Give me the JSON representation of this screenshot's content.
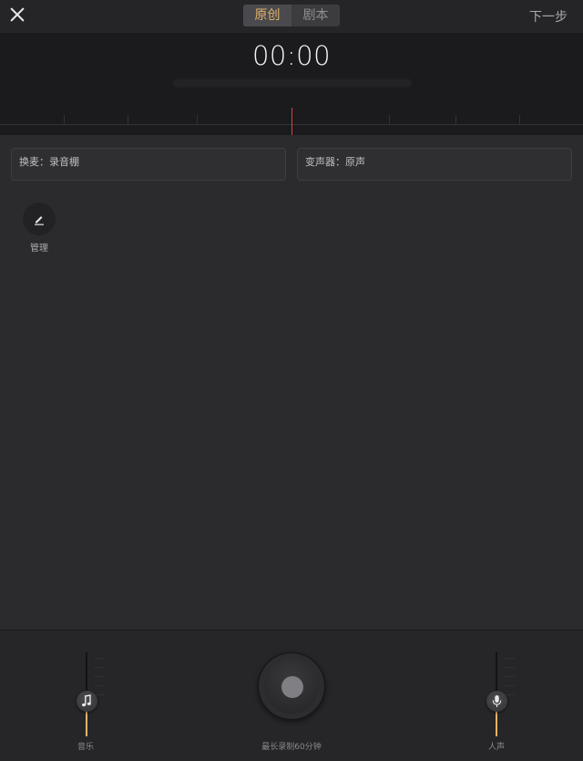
{
  "topbar": {
    "close_icon": "close-icon",
    "tabs": [
      {
        "label": "原创",
        "active": true
      },
      {
        "label": "剧本",
        "active": false
      }
    ],
    "next_label": "下一步"
  },
  "recorder": {
    "timer": "00:00"
  },
  "options": {
    "mic_label": "换麦：录音棚",
    "voice_changer_label": "变声器：原声"
  },
  "manage": {
    "icon": "edit-icon",
    "label": "管理"
  },
  "controls": {
    "music": {
      "label": "音乐",
      "icon": "music-note-icon",
      "level": 0.4
    },
    "voice": {
      "label": "人声",
      "icon": "microphone-icon",
      "level": 0.4
    },
    "record_hint": "最长录制60分钟",
    "record_icon": "record-button"
  },
  "colors": {
    "accent": "#e2b46a",
    "playhead": "#d9424a",
    "background": "#2b2b2d"
  }
}
